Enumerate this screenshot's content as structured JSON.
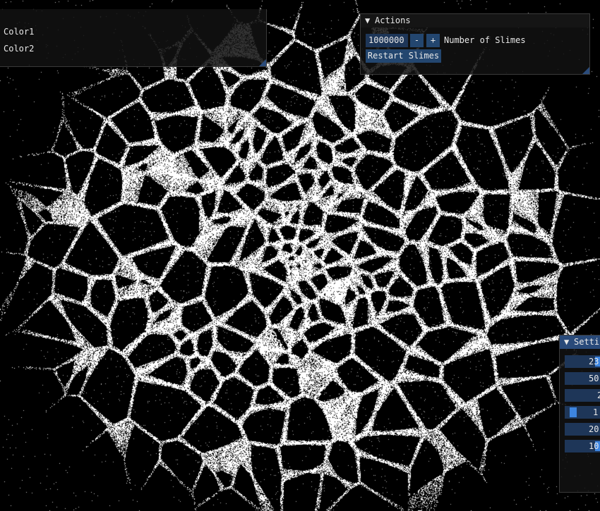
{
  "colors_window": {
    "items": [
      {
        "label": "Color1"
      },
      {
        "label": "Color2"
      }
    ]
  },
  "actions_window": {
    "title": "Actions",
    "collapse_arrow": "triangle-down-icon",
    "slime_count_value": "1000000",
    "minus_label": "-",
    "plus_label": "+",
    "slime_count_label": "Number of Slimes",
    "restart_label": "Restart Slimes"
  },
  "settings_window": {
    "title": "Setti",
    "collapse_arrow": "triangle-down-icon",
    "fields": [
      {
        "value": "23.",
        "level": 0.9
      },
      {
        "value": "50.",
        "level": null
      },
      {
        "value": "2",
        "level": null
      },
      {
        "value": "1.",
        "level": 0.1
      },
      {
        "value": "20.",
        "level": null
      },
      {
        "value": "10.",
        "level": 0.9
      }
    ]
  },
  "theme": {
    "window_bg": "#121212",
    "title_active": "#294a7a",
    "frame_bg": "#1e3658",
    "button": "#23466f",
    "slider_grab": "#3d85e0",
    "text": "#e8e8e8",
    "sim_particles": "#ffffff",
    "sim_background": "#000000"
  }
}
